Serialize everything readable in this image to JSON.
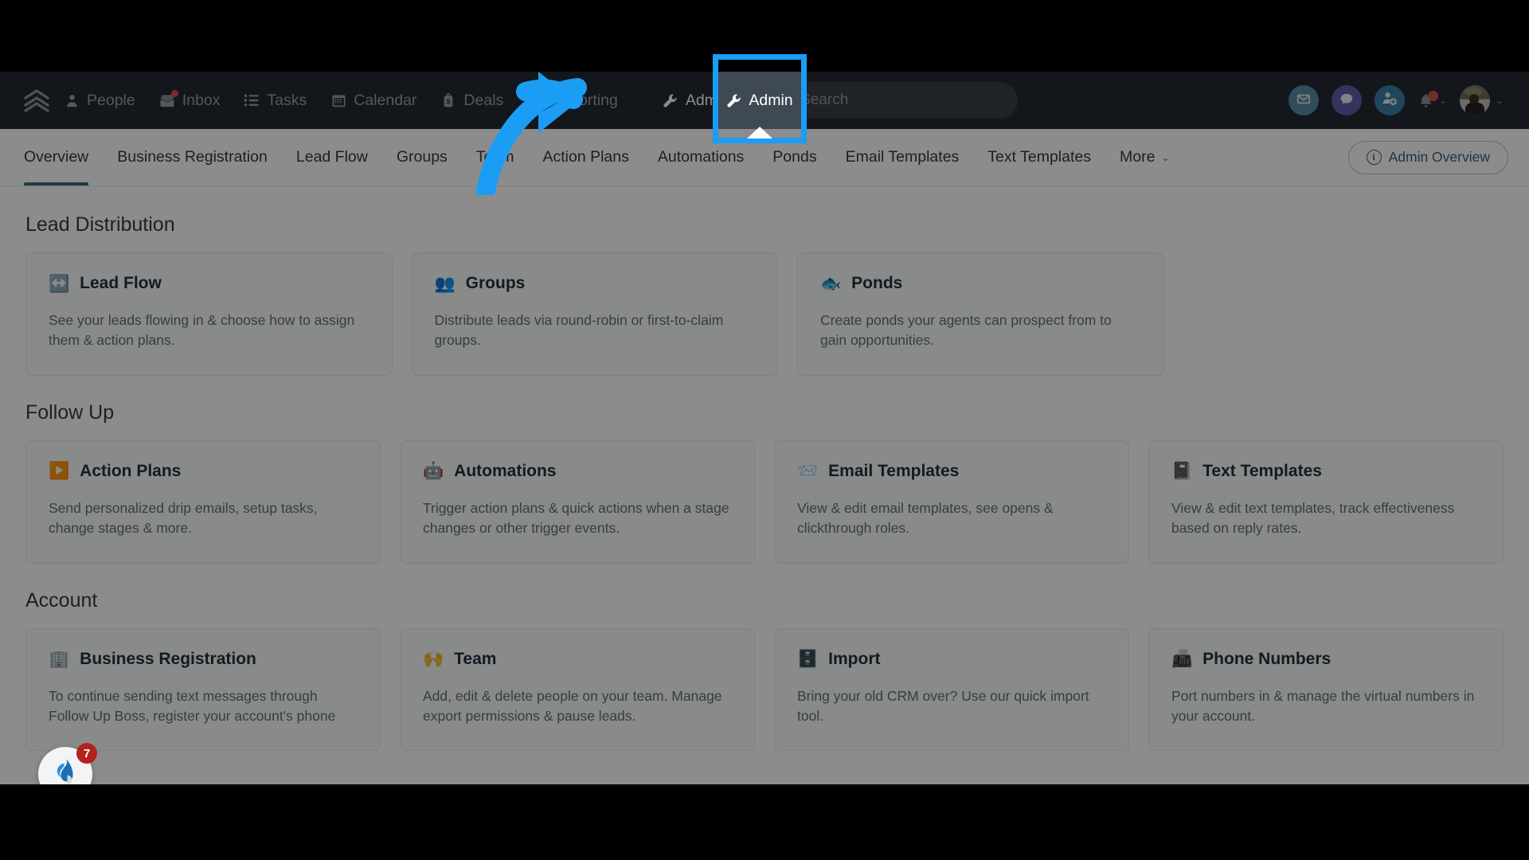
{
  "topnav": {
    "logo_icon": "chevrons-up-icon",
    "items": [
      {
        "label": "People",
        "icon": "person-icon",
        "badge": false
      },
      {
        "label": "Inbox",
        "icon": "inbox-icon",
        "badge": true
      },
      {
        "label": "Tasks",
        "icon": "list-icon",
        "badge": false
      },
      {
        "label": "Calendar",
        "icon": "calendar-icon",
        "badge": false
      },
      {
        "label": "Deals",
        "icon": "tag-icon",
        "badge": false
      },
      {
        "label": "Reporting",
        "icon": "chart-icon",
        "badge": false
      }
    ],
    "admin": {
      "label": "Admin",
      "icon": "wrench-icon"
    },
    "search": {
      "value": "",
      "placeholder": "Search",
      "icon": "search-icon"
    },
    "actions": [
      {
        "name": "mail",
        "icon": "envelope-icon",
        "color": "#5b8ba8"
      },
      {
        "name": "chat",
        "icon": "chat-bubble-icon",
        "color": "#5f5fae"
      },
      {
        "name": "adduser",
        "icon": "add-person-icon",
        "color": "#3b7fa8"
      }
    ],
    "notifications": {
      "icon": "bell-icon",
      "has_badge": true,
      "chevron": "⌄"
    },
    "avatar": {
      "chevron": "⌄"
    }
  },
  "subnav": {
    "tabs": [
      {
        "label": "Overview",
        "active": true
      },
      {
        "label": "Business Registration",
        "active": false
      },
      {
        "label": "Lead Flow",
        "active": false
      },
      {
        "label": "Groups",
        "active": false
      },
      {
        "label": "Team",
        "active": false
      },
      {
        "label": "Action Plans",
        "active": false
      },
      {
        "label": "Automations",
        "active": false
      },
      {
        "label": "Ponds",
        "active": false
      },
      {
        "label": "Email Templates",
        "active": false
      },
      {
        "label": "Text Templates",
        "active": false
      },
      {
        "label": "More",
        "active": false,
        "caret": "⌄"
      }
    ],
    "admin_overview_button": {
      "label": "Admin Overview",
      "icon": "info-circle-icon",
      "glyph": "i"
    }
  },
  "sections": [
    {
      "title": "Lead Distribution",
      "cards": [
        {
          "emoji": "↔️",
          "icon_name": "left-right-arrow-icon",
          "title": "Lead Flow",
          "desc": "See your leads flowing in & choose how to assign them & action plans."
        },
        {
          "emoji": "👥",
          "icon_name": "two-people-icon",
          "title": "Groups",
          "desc": "Distribute leads via round-robin or first-to-claim groups."
        },
        {
          "emoji": "🐟",
          "icon_name": "fish-icon",
          "title": "Ponds",
          "desc": "Create ponds your agents can prospect from to gain opportunities."
        }
      ],
      "has_spacer": true
    },
    {
      "title": "Follow Up",
      "cards": [
        {
          "emoji": "▶️",
          "icon_name": "play-button-icon",
          "title": "Action Plans",
          "desc": "Send personalized drip emails, setup tasks, change stages & more."
        },
        {
          "emoji": "🤖",
          "icon_name": "robot-icon",
          "title": "Automations",
          "desc": "Trigger action plans & quick actions when a stage changes or other trigger events."
        },
        {
          "emoji": "📨",
          "icon_name": "incoming-envelope-icon",
          "title": "Email Templates",
          "desc": "View & edit email templates, see opens & clickthrough roles."
        },
        {
          "emoji": "📓",
          "icon_name": "notebook-icon",
          "title": "Text Templates",
          "desc": "View & edit text templates, track effectiveness based on reply rates."
        }
      ],
      "has_spacer": false
    },
    {
      "title": "Account",
      "cards": [
        {
          "emoji": "🏢",
          "icon_name": "office-building-icon",
          "title": "Business Registration",
          "desc": "To continue sending text messages through Follow Up Boss, register your account's phone"
        },
        {
          "emoji": "🙌",
          "icon_name": "raised-hands-icon",
          "title": "Team",
          "desc": "Add, edit & delete people on your team. Manage export permissions & pause leads."
        },
        {
          "emoji": "🗄️",
          "icon_name": "file-cabinet-icon",
          "title": "Import",
          "desc": "Bring your old CRM over? Use our quick import tool."
        },
        {
          "emoji": "📠",
          "icon_name": "fax-machine-icon",
          "title": "Phone Numbers",
          "desc": "Port numbers in & manage the virtual numbers in your account."
        }
      ],
      "has_spacer": false
    }
  ],
  "widgets": {
    "fub_badge": {
      "count": "7",
      "icon_name": "flame-logo-icon"
    },
    "help_button": {
      "label": "?",
      "icon_name": "question-mark-icon"
    }
  },
  "annotation": {
    "arrow_color": "#1c9df5",
    "highlight_color": "#1c9df5",
    "target": "Admin"
  }
}
